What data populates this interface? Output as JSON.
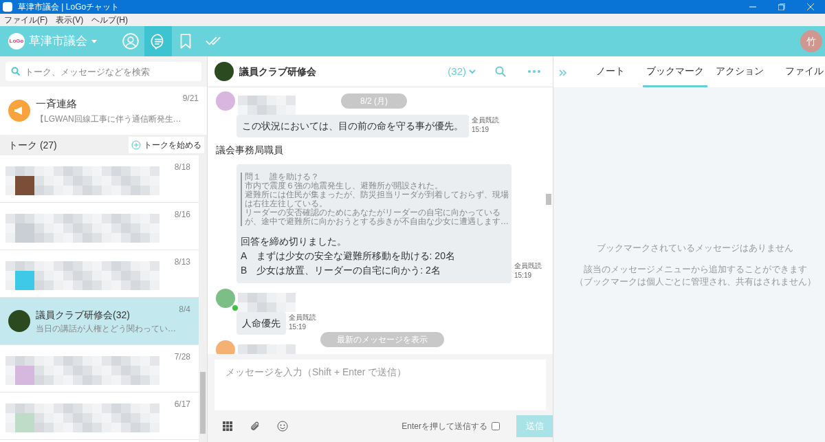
{
  "window": {
    "title": "草津市議会 | LoGoチャット"
  },
  "menu": [
    "ファイル(F)",
    "表示(V)",
    "ヘルプ(H)"
  ],
  "header": {
    "logo": "LoGo",
    "org": "草津市議会",
    "nav": [
      {
        "kind": "profile",
        "selected": false
      },
      {
        "kind": "chat",
        "selected": true
      },
      {
        "kind": "bookmark",
        "selected": false
      },
      {
        "kind": "check",
        "selected": false
      }
    ],
    "user": "竹"
  },
  "sidebar": {
    "search": {
      "placeholder": "トーク、メッセージなどを検索"
    },
    "broadcast": {
      "title": "一斉連絡",
      "preview": "【LGWAN回線工事に伴う通信断発生…",
      "date": "9/21"
    },
    "talk_header": {
      "title": "トーク (27)",
      "start": "トークを始める"
    },
    "talks": [
      {
        "kind": "blurred",
        "date": "8/18",
        "color": "#7a4e37",
        "selected": false
      },
      {
        "kind": "blurred",
        "date": "8/16",
        "color": "#c9cfd4",
        "selected": false
      },
      {
        "kind": "blurred",
        "date": "8/13",
        "color": "#3ec9e6",
        "selected": false
      },
      {
        "kind": "group",
        "date": "8/4",
        "name": "議員クラブ研修会(32)",
        "preview": "当日の講話が人権とどう関わってい…",
        "selected": true
      },
      {
        "kind": "blurred",
        "date": "7/28",
        "color": "#d6b8de",
        "selected": false
      },
      {
        "kind": "blurred",
        "date": "6/17",
        "color": "#bfdcc8",
        "selected": false
      }
    ]
  },
  "chat": {
    "title": "議員クラブ研修会",
    "count": "(32)",
    "date_pill": "8/2 (月)",
    "jump": "最新のメッセージを表示",
    "messages": [
      {
        "kind": "text",
        "color": "#d8b6e0",
        "online": false,
        "text": "この状況においては、目の前の命を守る事が優先。",
        "read": "全員既読",
        "time": "15:19"
      },
      {
        "kind": "poll",
        "sender": "議会事務局職員",
        "quote": [
          "問１　誰を助ける？",
          "市内で震度６強の地震発生し、避難所が開設された。",
          "避難所には住民が集まったが、防災担当リーダが到着しておらず、現場",
          "は右往左往している。",
          "リーダーの安否確認のためにあなたがリーダーの自宅に向かっている",
          "が、途中で避難所に向かおうとする歩きが不自由な少女に遭遇します…"
        ],
        "body": [
          "回答を締め切りました。",
          "A　まずは少女の安全な避難所移動を助ける: 20名",
          "B　少女は放置、リーダーの自宅に向かう: 2名"
        ],
        "read": "全員既読",
        "time": "15:19"
      },
      {
        "kind": "text",
        "color": "#7cbf86",
        "online": true,
        "text": "人命優先",
        "read": "全員既読",
        "time": "15:19"
      },
      {
        "kind": "cut",
        "color": "#f5b074"
      }
    ],
    "composer": {
      "placeholder": "メッセージを入力（Shift + Enter で送信）",
      "enter_label": "Enterを押して送信する",
      "enter_checked": false,
      "send": "送信",
      "send_disabled": true
    }
  },
  "panel": {
    "tabs": [
      {
        "label": "ノート",
        "selected": false
      },
      {
        "label": "ブックマーク",
        "selected": true
      },
      {
        "label": "アクション",
        "selected": false
      },
      {
        "label": "ファイル",
        "selected": false
      }
    ],
    "empty": "ブックマークされているメッセージはありません",
    "hint": [
      "該当のメッセージメニューから追加することができます",
      "（ブックマークは個人ごとに管理され、共有はされません）"
    ]
  }
}
